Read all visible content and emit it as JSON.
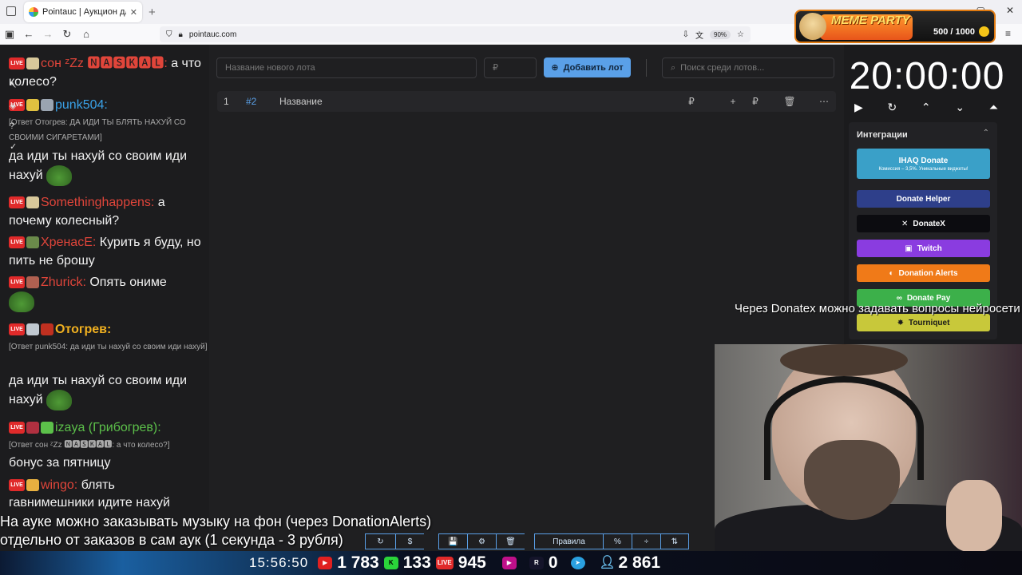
{
  "browser": {
    "tab_title": "Pointauc | Аукцион для стриме",
    "tab_close": "✕",
    "new_tab": "+",
    "url": "pointauc.com",
    "zoom": "90%",
    "window_controls": [
      "—",
      "▢",
      "✕"
    ],
    "menu": "≡"
  },
  "meme_party": {
    "title": "MEME PARTY",
    "score": "500 / 1000"
  },
  "chat": {
    "messages": [
      {
        "nick": "сон ᶻZz 🅽🅰🆂🅺🅰🅻:",
        "nick_color": "#e0453a",
        "text": " а что колесо?"
      },
      {
        "nick": "punk504:",
        "nick_color": "#3aa2e8",
        "text": ""
      },
      {
        "reply": "[Ответ Отогрев: ДА ИДИ ТЫ БЛЯТЬ НАХУЙ СО СВОИМИ СИГАРЕТАМИ]"
      },
      {
        "text": "да иди ты нахуй со своим иди нахуй"
      },
      {
        "nick": "Somethinghappens:",
        "nick_color": "#e0453a",
        "text": " а почему колесный?"
      },
      {
        "nick": "ХренасЕ:",
        "nick_color": "#e0453a",
        "text": " Курить я буду, но пить не брошу"
      },
      {
        "nick": "Zhurick:",
        "nick_color": "#e0453a",
        "text": " Опять ониме"
      },
      {
        "nick": "Отогрев:",
        "nick_color": "#f0b020",
        "text": ""
      },
      {
        "reply": "[Ответ punk504: да иди ты нахуй со своим иди нахуй]"
      },
      {
        "text": "да иди ты нахуй со своим иди нахуй"
      },
      {
        "nick": "izaya (Грибогрев):",
        "nick_color": "#5cc04a",
        "text": ""
      },
      {
        "reply": "[Ответ сон ᶻZz 🅽🅰🆂🅺🅰🅻: а что колесо?]"
      },
      {
        "text": "бонус за пятницу"
      },
      {
        "nick": "wingo:",
        "nick_color": "#e0453a",
        "text": " блять"
      },
      {
        "text": "гавнимешники идите нахуй"
      }
    ],
    "live_label": "LIVE"
  },
  "auction": {
    "new_lot_placeholder": "Название нового лота",
    "amount_placeholder": "₽",
    "add_button": "Добавить лот",
    "search_placeholder": "Поиск среди лотов...",
    "lot": {
      "num": "1",
      "id": "#2",
      "name": "Название",
      "currency": "₽",
      "currency2": "₽"
    }
  },
  "timer": {
    "value": "20:00:00"
  },
  "integrations": {
    "title": "Интеграции",
    "items": [
      {
        "label": "IHAQ Donate",
        "sub": "Комиссия – 3,5%. Уникальные виджеты!",
        "color": "#3aa0c8"
      },
      {
        "label": "Donate Helper",
        "color": "#2e3f8a"
      },
      {
        "label": "DonateX",
        "color": "#0c0c10"
      },
      {
        "label": "Twitch",
        "color": "#8a3ce0"
      },
      {
        "label": "Donation Alerts",
        "color": "#f07a18"
      },
      {
        "label": "Donate Pay",
        "color": "#3cb04a"
      },
      {
        "label": "Tourniquet",
        "color": "#c8c83a"
      }
    ]
  },
  "overlay_text": "Через Donatex можно задавать вопросы нейросети",
  "bottom_buttons": [
    "↻",
    "$",
    "💾",
    "⚙",
    "🗑",
    "Правила",
    "%",
    "÷",
    "⇅"
  ],
  "subtitle": {
    "line1": "На ауке можно заказывать музыку на фон (через DonationAlerts)",
    "line2": "отдельно от заказов в сам аук (1 секунда - 3 рубля)"
  },
  "stats": {
    "time": "15:56:50",
    "youtube": "1 783",
    "kick": "133",
    "vk": "945",
    "rutube": "0",
    "viewers": "2 861"
  }
}
